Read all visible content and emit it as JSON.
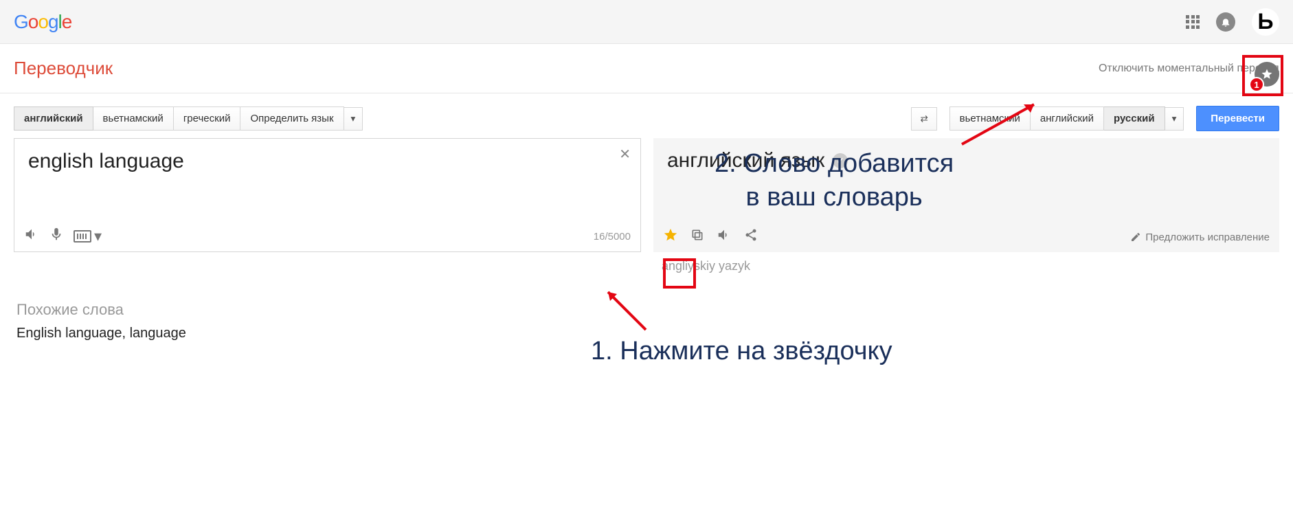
{
  "header": {
    "logo_text": "Google",
    "avatar_letter": "Ь"
  },
  "subheader": {
    "app_title": "Переводчик",
    "instant_off": "Отключить моментальный перевод",
    "phrasebook_badge": "1"
  },
  "source_langs": {
    "tabs": [
      "английский",
      "вьетнамский",
      "греческий",
      "Определить язык"
    ],
    "active_index": 0
  },
  "target_langs": {
    "tabs": [
      "вьетнамский",
      "английский",
      "русский"
    ],
    "active_index": 2,
    "translate_btn": "Перевести"
  },
  "source": {
    "text": "english language",
    "charcount": "16/5000"
  },
  "target": {
    "text": "английский язык",
    "transliteration": "angliyskiy yazyk",
    "suggest_edit": "Предложить исправление"
  },
  "related": {
    "title": "Похожие слова",
    "items": "English language, language"
  },
  "annotations": {
    "step1": "1. Нажмите на звёздочку",
    "step2": "2. Слово добавится\nв ваш словарь"
  }
}
